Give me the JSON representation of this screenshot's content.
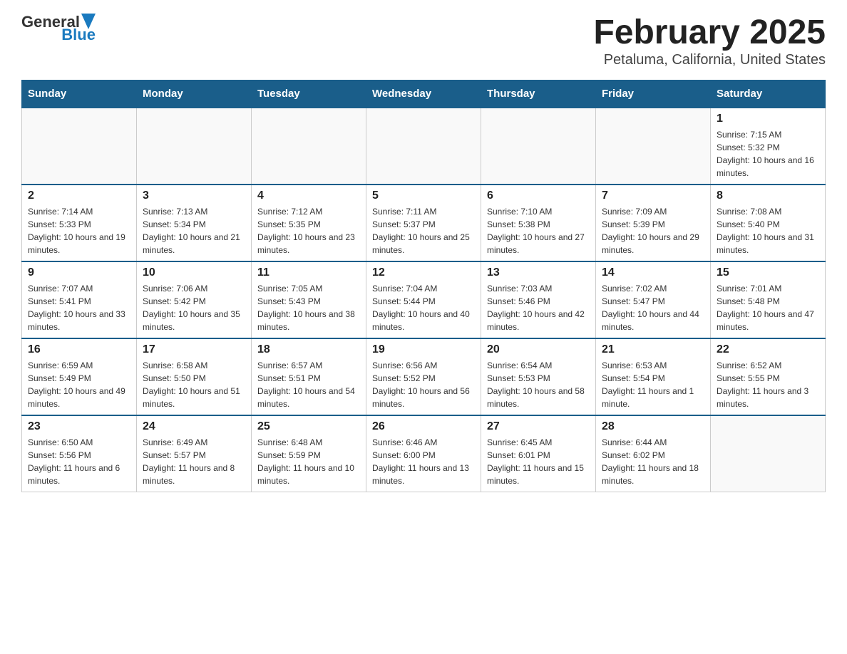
{
  "header": {
    "logo_general": "General",
    "logo_blue": "Blue",
    "title": "February 2025",
    "subtitle": "Petaluma, California, United States"
  },
  "days_of_week": [
    "Sunday",
    "Monday",
    "Tuesday",
    "Wednesday",
    "Thursday",
    "Friday",
    "Saturday"
  ],
  "weeks": [
    [
      {
        "day": "",
        "info": ""
      },
      {
        "day": "",
        "info": ""
      },
      {
        "day": "",
        "info": ""
      },
      {
        "day": "",
        "info": ""
      },
      {
        "day": "",
        "info": ""
      },
      {
        "day": "",
        "info": ""
      },
      {
        "day": "1",
        "info": "Sunrise: 7:15 AM\nSunset: 5:32 PM\nDaylight: 10 hours and 16 minutes."
      }
    ],
    [
      {
        "day": "2",
        "info": "Sunrise: 7:14 AM\nSunset: 5:33 PM\nDaylight: 10 hours and 19 minutes."
      },
      {
        "day": "3",
        "info": "Sunrise: 7:13 AM\nSunset: 5:34 PM\nDaylight: 10 hours and 21 minutes."
      },
      {
        "day": "4",
        "info": "Sunrise: 7:12 AM\nSunset: 5:35 PM\nDaylight: 10 hours and 23 minutes."
      },
      {
        "day": "5",
        "info": "Sunrise: 7:11 AM\nSunset: 5:37 PM\nDaylight: 10 hours and 25 minutes."
      },
      {
        "day": "6",
        "info": "Sunrise: 7:10 AM\nSunset: 5:38 PM\nDaylight: 10 hours and 27 minutes."
      },
      {
        "day": "7",
        "info": "Sunrise: 7:09 AM\nSunset: 5:39 PM\nDaylight: 10 hours and 29 minutes."
      },
      {
        "day": "8",
        "info": "Sunrise: 7:08 AM\nSunset: 5:40 PM\nDaylight: 10 hours and 31 minutes."
      }
    ],
    [
      {
        "day": "9",
        "info": "Sunrise: 7:07 AM\nSunset: 5:41 PM\nDaylight: 10 hours and 33 minutes."
      },
      {
        "day": "10",
        "info": "Sunrise: 7:06 AM\nSunset: 5:42 PM\nDaylight: 10 hours and 35 minutes."
      },
      {
        "day": "11",
        "info": "Sunrise: 7:05 AM\nSunset: 5:43 PM\nDaylight: 10 hours and 38 minutes."
      },
      {
        "day": "12",
        "info": "Sunrise: 7:04 AM\nSunset: 5:44 PM\nDaylight: 10 hours and 40 minutes."
      },
      {
        "day": "13",
        "info": "Sunrise: 7:03 AM\nSunset: 5:46 PM\nDaylight: 10 hours and 42 minutes."
      },
      {
        "day": "14",
        "info": "Sunrise: 7:02 AM\nSunset: 5:47 PM\nDaylight: 10 hours and 44 minutes."
      },
      {
        "day": "15",
        "info": "Sunrise: 7:01 AM\nSunset: 5:48 PM\nDaylight: 10 hours and 47 minutes."
      }
    ],
    [
      {
        "day": "16",
        "info": "Sunrise: 6:59 AM\nSunset: 5:49 PM\nDaylight: 10 hours and 49 minutes."
      },
      {
        "day": "17",
        "info": "Sunrise: 6:58 AM\nSunset: 5:50 PM\nDaylight: 10 hours and 51 minutes."
      },
      {
        "day": "18",
        "info": "Sunrise: 6:57 AM\nSunset: 5:51 PM\nDaylight: 10 hours and 54 minutes."
      },
      {
        "day": "19",
        "info": "Sunrise: 6:56 AM\nSunset: 5:52 PM\nDaylight: 10 hours and 56 minutes."
      },
      {
        "day": "20",
        "info": "Sunrise: 6:54 AM\nSunset: 5:53 PM\nDaylight: 10 hours and 58 minutes."
      },
      {
        "day": "21",
        "info": "Sunrise: 6:53 AM\nSunset: 5:54 PM\nDaylight: 11 hours and 1 minute."
      },
      {
        "day": "22",
        "info": "Sunrise: 6:52 AM\nSunset: 5:55 PM\nDaylight: 11 hours and 3 minutes."
      }
    ],
    [
      {
        "day": "23",
        "info": "Sunrise: 6:50 AM\nSunset: 5:56 PM\nDaylight: 11 hours and 6 minutes."
      },
      {
        "day": "24",
        "info": "Sunrise: 6:49 AM\nSunset: 5:57 PM\nDaylight: 11 hours and 8 minutes."
      },
      {
        "day": "25",
        "info": "Sunrise: 6:48 AM\nSunset: 5:59 PM\nDaylight: 11 hours and 10 minutes."
      },
      {
        "day": "26",
        "info": "Sunrise: 6:46 AM\nSunset: 6:00 PM\nDaylight: 11 hours and 13 minutes."
      },
      {
        "day": "27",
        "info": "Sunrise: 6:45 AM\nSunset: 6:01 PM\nDaylight: 11 hours and 15 minutes."
      },
      {
        "day": "28",
        "info": "Sunrise: 6:44 AM\nSunset: 6:02 PM\nDaylight: 11 hours and 18 minutes."
      },
      {
        "day": "",
        "info": ""
      }
    ]
  ]
}
